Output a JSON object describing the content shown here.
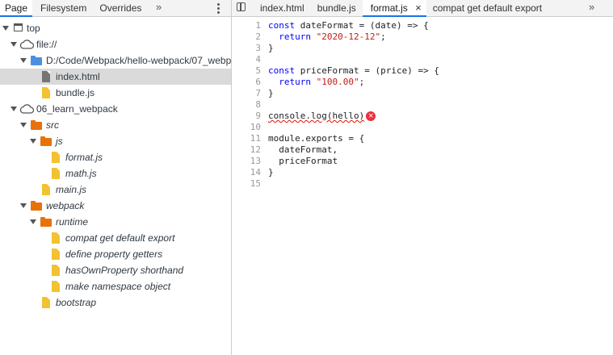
{
  "left_panel": {
    "tabs": [
      {
        "label": "Page"
      },
      {
        "label": "Filesystem"
      },
      {
        "label": "Overrides"
      }
    ],
    "more_label": "»",
    "tree": [
      {
        "label": "top",
        "kind": "frame"
      },
      {
        "label": "file://",
        "kind": "cloud"
      },
      {
        "label": "D:/Code/Webpack/hello-webpack/07_webp",
        "kind": "folder-blue"
      },
      {
        "label": "index.html",
        "kind": "file-gray",
        "selected": true
      },
      {
        "label": "bundle.js",
        "kind": "file-yellow"
      },
      {
        "label": "06_learn_webpack",
        "kind": "cloud"
      },
      {
        "label": "src",
        "kind": "folder-orange"
      },
      {
        "label": "js",
        "kind": "folder-orange"
      },
      {
        "label": "format.js",
        "kind": "file-yellow"
      },
      {
        "label": "math.js",
        "kind": "file-yellow"
      },
      {
        "label": "main.js",
        "kind": "file-yellow"
      },
      {
        "label": "webpack",
        "kind": "folder-orange"
      },
      {
        "label": "runtime",
        "kind": "folder-orange"
      },
      {
        "label": "compat get default export",
        "kind": "file-yellow"
      },
      {
        "label": "define property getters",
        "kind": "file-yellow"
      },
      {
        "label": "hasOwnProperty shorthand",
        "kind": "file-yellow"
      },
      {
        "label": "make namespace object",
        "kind": "file-yellow"
      },
      {
        "label": "bootstrap",
        "kind": "file-yellow"
      }
    ]
  },
  "editor": {
    "tabs": [
      {
        "label": "index.html"
      },
      {
        "label": "bundle.js"
      },
      {
        "label": "format.js",
        "active": true,
        "close": "×"
      },
      {
        "label": "compat get default export"
      }
    ],
    "more_label": "»",
    "line_numbers": [
      "1",
      "2",
      "3",
      "4",
      "5",
      "6",
      "7",
      "8",
      "9",
      "10",
      "11",
      "12",
      "13",
      "14",
      "15"
    ],
    "code": {
      "l1a": "const",
      "l1b": " dateFormat = (date) => {",
      "l2a": "  return ",
      "l2b": "\"2020-12-12\"",
      "l2c": ";",
      "l3": "}",
      "l5a": "const",
      "l5b": " priceFormat = (price) => {",
      "l6a": "  return ",
      "l6b": "\"100.00\"",
      "l6c": ";",
      "l7": "}",
      "l9": "console.log(hello)",
      "l11": "module.exports = {",
      "l12": "  dateFormat,",
      "l13": "  priceFormat",
      "l14": "}"
    },
    "error_icon": "×"
  },
  "colors": {
    "folder_blue": "#4a90e2",
    "folder_orange": "#e8710a",
    "file_yellow": "#f2c230",
    "file_gray": "#757575",
    "keyword": "#0000ff",
    "string": "#c41a16",
    "error": "#e8323a",
    "active_tab_underline": "#1a73e8"
  }
}
